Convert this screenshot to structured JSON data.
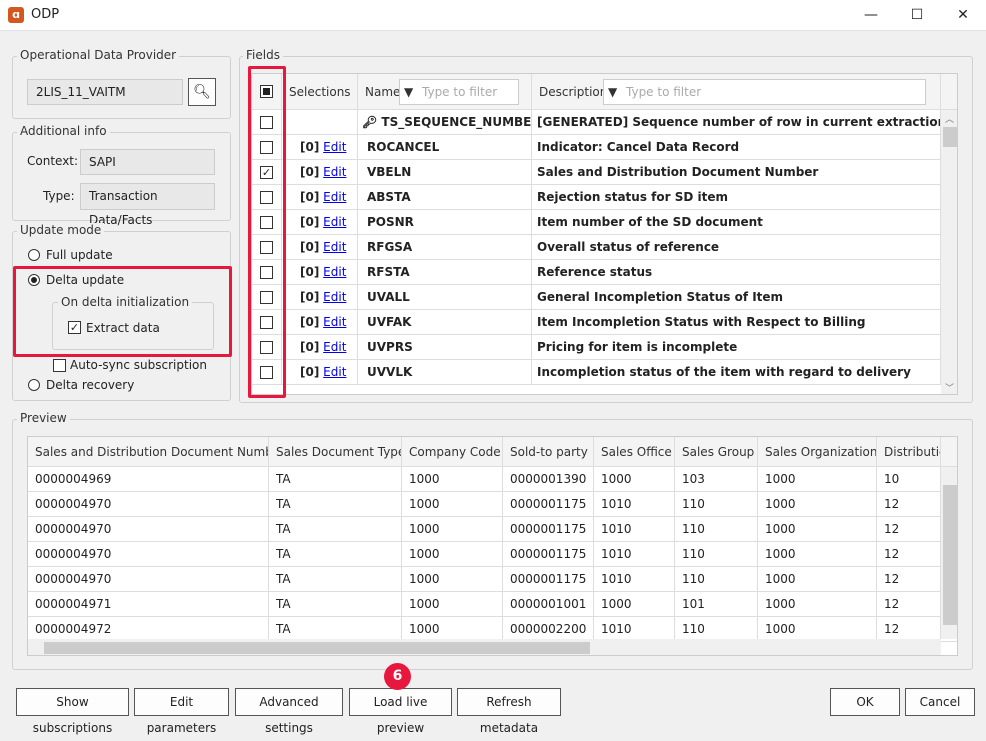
{
  "window": {
    "title": "ODP",
    "min": "—",
    "max": "☐",
    "close": "✕"
  },
  "odp": {
    "label": "Operational Data Provider",
    "value": "2LIS_11_VAITM"
  },
  "info": {
    "label": "Additional info",
    "context_label": "Context:",
    "context": "SAPI",
    "type_label": "Type:",
    "type": "Transaction Data/Facts"
  },
  "update": {
    "label": "Update mode",
    "full": "Full update",
    "delta": "Delta update",
    "delta_init": "On delta initialization",
    "extract": "Extract data",
    "autosync": "Auto-sync subscription",
    "recovery": "Delta recovery",
    "selected": "Delta update",
    "extract_checked": true,
    "autosync_checked": false
  },
  "fields": {
    "label": "Fields",
    "headers": {
      "selections": "Selections",
      "name": "Name",
      "description": "Description",
      "filter_placeholder": "Type to filter"
    },
    "rows": [
      {
        "checked": false,
        "sel": "",
        "edit": "",
        "name": "TS_SEQUENCE_NUMBER",
        "desc": "[GENERATED] Sequence number of row in current extraction",
        "key": true
      },
      {
        "checked": false,
        "sel": "[0]",
        "edit": "Edit",
        "name": "ROCANCEL",
        "desc": "Indicator: Cancel Data Record"
      },
      {
        "checked": true,
        "sel": "[0]",
        "edit": "Edit",
        "name": "VBELN",
        "desc": "Sales and Distribution Document Number"
      },
      {
        "checked": false,
        "sel": "[0]",
        "edit": "Edit",
        "name": "ABSTA",
        "desc": "Rejection status for SD item"
      },
      {
        "checked": false,
        "sel": "[0]",
        "edit": "Edit",
        "name": "POSNR",
        "desc": "Item number of the SD document"
      },
      {
        "checked": false,
        "sel": "[0]",
        "edit": "Edit",
        "name": "RFGSA",
        "desc": "Overall status of reference"
      },
      {
        "checked": false,
        "sel": "[0]",
        "edit": "Edit",
        "name": "RFSTA",
        "desc": "Reference status"
      },
      {
        "checked": false,
        "sel": "[0]",
        "edit": "Edit",
        "name": "UVALL",
        "desc": "General Incompletion Status of Item"
      },
      {
        "checked": false,
        "sel": "[0]",
        "edit": "Edit",
        "name": "UVFAK",
        "desc": "Item Incompletion Status with Respect to Billing"
      },
      {
        "checked": false,
        "sel": "[0]",
        "edit": "Edit",
        "name": "UVPRS",
        "desc": "Pricing for item is incomplete"
      },
      {
        "checked": false,
        "sel": "[0]",
        "edit": "Edit",
        "name": "UVVLK",
        "desc": "Incompletion status of the item with regard to delivery"
      }
    ]
  },
  "preview": {
    "label": "Preview",
    "headers": [
      "Sales and Distribution Document Number",
      "Sales Document Type",
      "Company Code",
      "Sold-to party",
      "Sales Office",
      "Sales Group",
      "Sales Organization",
      "Distribution"
    ],
    "rows": [
      [
        "0000004969",
        "TA",
        "1000",
        "0000001390",
        "1000",
        "103",
        "1000",
        "10"
      ],
      [
        "0000004970",
        "TA",
        "1000",
        "0000001175",
        "1010",
        "110",
        "1000",
        "12"
      ],
      [
        "0000004970",
        "TA",
        "1000",
        "0000001175",
        "1010",
        "110",
        "1000",
        "12"
      ],
      [
        "0000004970",
        "TA",
        "1000",
        "0000001175",
        "1010",
        "110",
        "1000",
        "12"
      ],
      [
        "0000004970",
        "TA",
        "1000",
        "0000001175",
        "1010",
        "110",
        "1000",
        "12"
      ],
      [
        "0000004971",
        "TA",
        "1000",
        "0000001001",
        "1000",
        "101",
        "1000",
        "12"
      ],
      [
        "0000004972",
        "TA",
        "1000",
        "0000002200",
        "1010",
        "110",
        "1000",
        "12"
      ]
    ]
  },
  "buttons": {
    "show_subs": "Show subscriptions",
    "edit_params": "Edit parameters",
    "advanced": "Advanced settings",
    "load_preview": "Load live preview",
    "refresh": "Refresh metadata",
    "ok": "OK",
    "cancel": "Cancel"
  },
  "badge": {
    "value": "6",
    "color": "#e8173e"
  }
}
